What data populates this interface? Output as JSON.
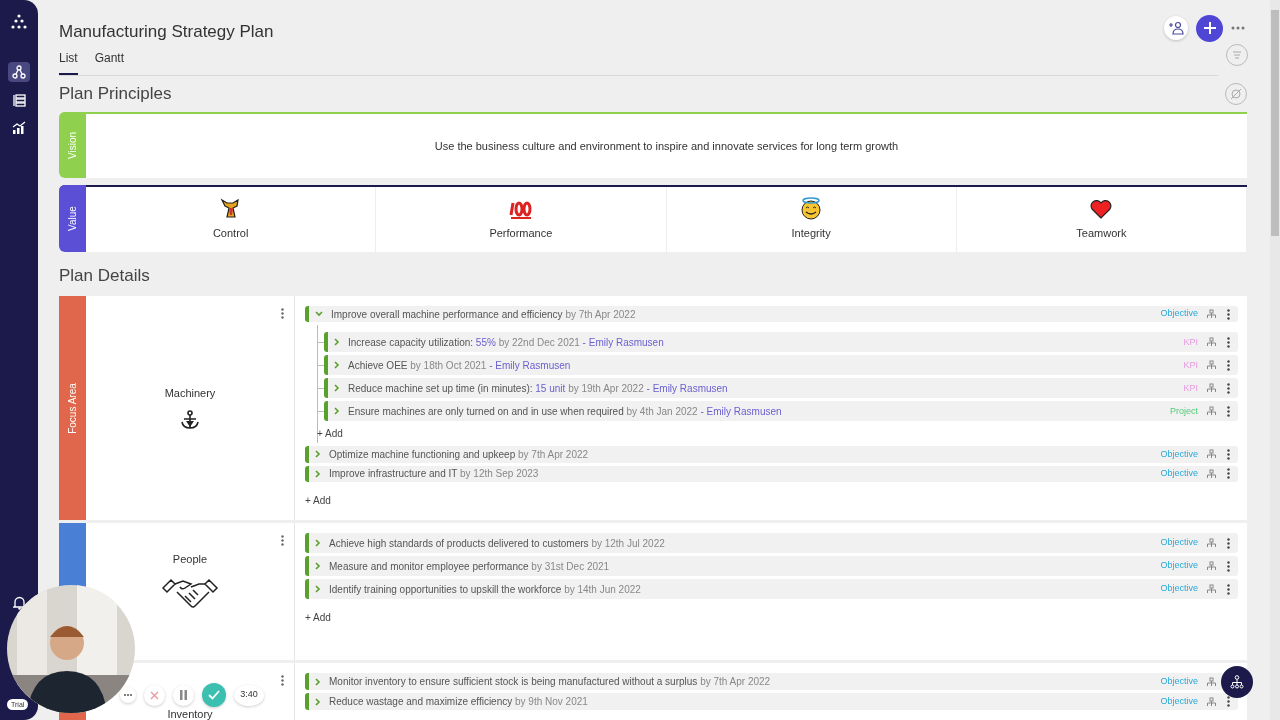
{
  "title": "Manufacturing Strategy Plan",
  "tabs": [
    {
      "label": "List",
      "selected": true
    },
    {
      "label": "Gantt",
      "selected": false
    }
  ],
  "principles": {
    "heading": "Plan Principles",
    "vision": {
      "label": "Vision",
      "text": "Use the business culture and environment to inspire and innovate services for long term growth"
    },
    "values": {
      "label": "Value",
      "items": [
        {
          "name": "Control"
        },
        {
          "name": "Performance"
        },
        {
          "name": "Integrity"
        },
        {
          "name": "Teamwork"
        }
      ]
    }
  },
  "details_heading": "Plan Details",
  "focus_areas": [
    {
      "label": "Focus Area",
      "color": "#e0674c",
      "name": "Machinery",
      "add": "+ Add",
      "items": [
        {
          "title": "Improve overall machine performance and efficiency",
          "due": "by 7th Apr 2022",
          "kind": "objective",
          "tag": "Objective",
          "expanded": true,
          "add": "+ Add",
          "children": [
            {
              "title": "Increase capacity utilization:",
              "value": "55%",
              "due": "by 22nd Dec 2021",
              "owner": "- Emily Rasmusen",
              "kind": "kpi",
              "tag": "KPI",
              "expanded": false
            },
            {
              "title": "Achieve OEE",
              "due": "by 18th Oct 2021",
              "owner": "- Emily Rasmusen",
              "kind": "kpi",
              "tag": "KPI",
              "expanded": false
            },
            {
              "title": "Reduce machine set up time (in minutes):",
              "value": "15 unit",
              "due": "by 19th Apr 2022",
              "owner": "- Emily Rasmusen",
              "kind": "kpi",
              "tag": "KPI",
              "expanded": false
            },
            {
              "title": "Ensure machines are only turned on and in use when required",
              "due": "by 4th Jan 2022",
              "owner": "- Emily Rasmusen",
              "kind": "project",
              "tag": "Project",
              "expanded": false
            }
          ]
        },
        {
          "title": "Optimize machine functioning and upkeep",
          "due": "by 7th Apr 2022",
          "kind": "objective",
          "tag": "Objective",
          "expanded": false
        },
        {
          "title": "Improve infrastructure and IT",
          "due": "by 12th Sep 2023",
          "kind": "objective",
          "tag": "Objective",
          "expanded": false
        }
      ]
    },
    {
      "color": "#4a7fd6",
      "name": "People",
      "add": "+ Add",
      "items": [
        {
          "title": "Achieve high standards of products delivered to customers",
          "due": "by 12th Jul 2022",
          "kind": "objective",
          "tag": "Objective",
          "expanded": false
        },
        {
          "title": "Measure and monitor employee performance",
          "due": "by 31st Dec 2021",
          "kind": "objective",
          "tag": "Objective",
          "expanded": false
        },
        {
          "title": "Identify training opportunities to upskill the workforce",
          "due": "by 14th Jun 2022",
          "kind": "objective",
          "tag": "Objective",
          "expanded": false
        }
      ]
    },
    {
      "color": "#e0674c",
      "name": "Inventory",
      "items": [
        {
          "title": "Monitor inventory to ensure sufficient stock is being manufactured without a surplus",
          "due": "by 7th Apr 2022",
          "kind": "objective",
          "tag": "Objective",
          "expanded": false
        },
        {
          "title": "Reduce wastage and maximize efficiency",
          "due": "by 9th Nov 2021",
          "kind": "objective",
          "tag": "Objective",
          "expanded": false
        }
      ]
    }
  ],
  "sidebar": {
    "badge": "Trial"
  },
  "recorder": {
    "time": "3:40"
  }
}
